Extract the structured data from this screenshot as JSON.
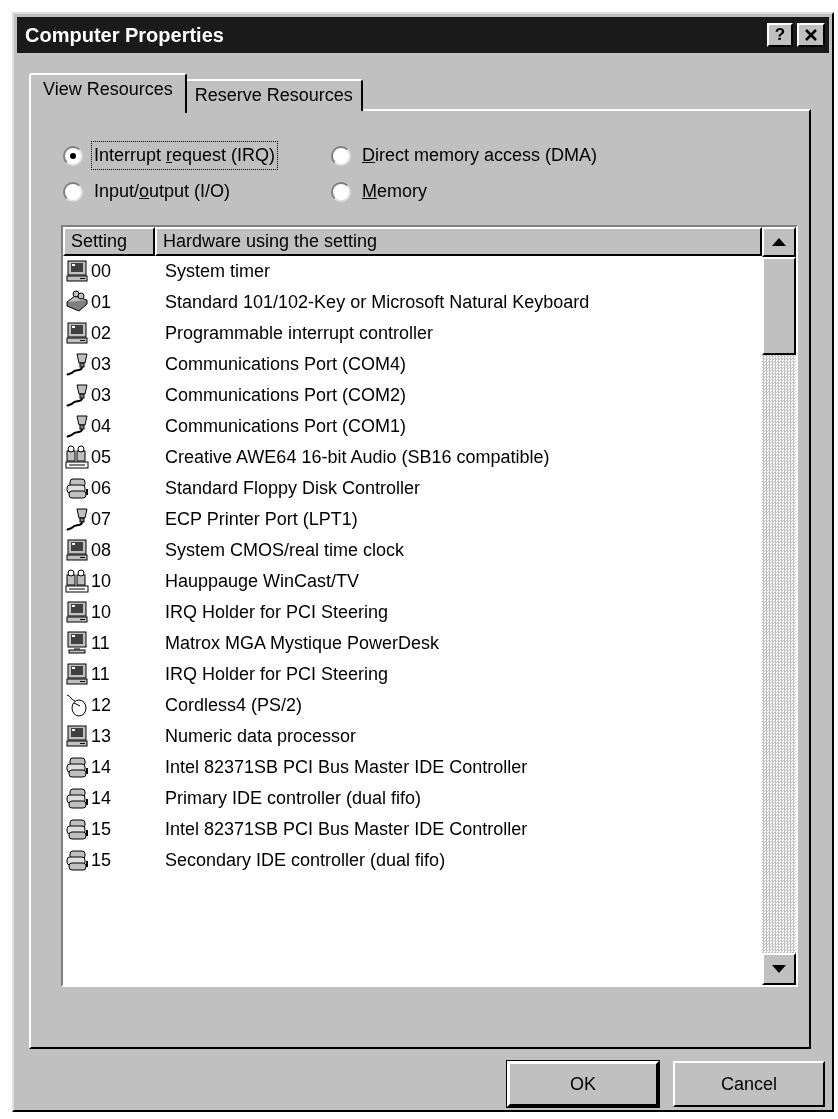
{
  "window": {
    "title": "Computer Properties",
    "help_button": "?"
  },
  "tabs": [
    {
      "label": "View Resources",
      "selected": true
    },
    {
      "label": "Reserve Resources",
      "selected": false
    }
  ],
  "radio_options": [
    {
      "before": "Interrupt ",
      "key": "r",
      "after": "equest (IRQ)",
      "selected": true,
      "focused": true
    },
    {
      "key": "D",
      "after": "irect memory access (DMA)",
      "selected": false,
      "focused": false
    },
    {
      "before": "Input/",
      "key": "o",
      "after": "utput (I/O)",
      "selected": false,
      "focused": false
    },
    {
      "key": "M",
      "after": "emory",
      "selected": false,
      "focused": false
    }
  ],
  "table": {
    "columns": [
      "Setting",
      "Hardware using the setting"
    ],
    "rows": [
      {
        "kind": "system",
        "setting": "00",
        "hardware": "System timer"
      },
      {
        "kind": "keyboard",
        "setting": "01",
        "hardware": "Standard 101/102-Key or Microsoft Natural Keyboard"
      },
      {
        "kind": "system",
        "setting": "02",
        "hardware": "Programmable interrupt controller"
      },
      {
        "kind": "port",
        "setting": "03",
        "hardware": "Communications Port (COM4)"
      },
      {
        "kind": "port",
        "setting": "03",
        "hardware": "Communications Port (COM2)"
      },
      {
        "kind": "port",
        "setting": "04",
        "hardware": "Communications Port (COM1)"
      },
      {
        "kind": "media",
        "setting": "05",
        "hardware": "Creative AWE64 16-bit Audio (SB16 compatible)"
      },
      {
        "kind": "disk",
        "setting": "06",
        "hardware": "Standard Floppy Disk Controller"
      },
      {
        "kind": "port",
        "setting": "07",
        "hardware": "ECP Printer Port (LPT1)"
      },
      {
        "kind": "system",
        "setting": "08",
        "hardware": "System CMOS/real time clock"
      },
      {
        "kind": "media",
        "setting": "10",
        "hardware": "Hauppauge WinCast/TV"
      },
      {
        "kind": "system",
        "setting": "10",
        "hardware": "IRQ Holder for PCI Steering"
      },
      {
        "kind": "monitor",
        "setting": "11",
        "hardware": "Matrox MGA Mystique PowerDesk"
      },
      {
        "kind": "system",
        "setting": "11",
        "hardware": "IRQ Holder for PCI Steering"
      },
      {
        "kind": "mouse",
        "setting": "12",
        "hardware": "Cordless4 (PS/2)"
      },
      {
        "kind": "system",
        "setting": "13",
        "hardware": "Numeric data processor"
      },
      {
        "kind": "disk",
        "setting": "14",
        "hardware": "Intel 82371SB PCI Bus Master IDE Controller"
      },
      {
        "kind": "disk",
        "setting": "14",
        "hardware": "Primary IDE controller (dual fifo)"
      },
      {
        "kind": "disk",
        "setting": "15",
        "hardware": "Intel 82371SB PCI Bus Master IDE Controller"
      },
      {
        "kind": "disk",
        "setting": "15",
        "hardware": "Secondary IDE controller (dual fifo)"
      }
    ]
  },
  "buttons": [
    {
      "label": "OK",
      "default": true
    },
    {
      "label": "Cancel",
      "default": false
    }
  ]
}
